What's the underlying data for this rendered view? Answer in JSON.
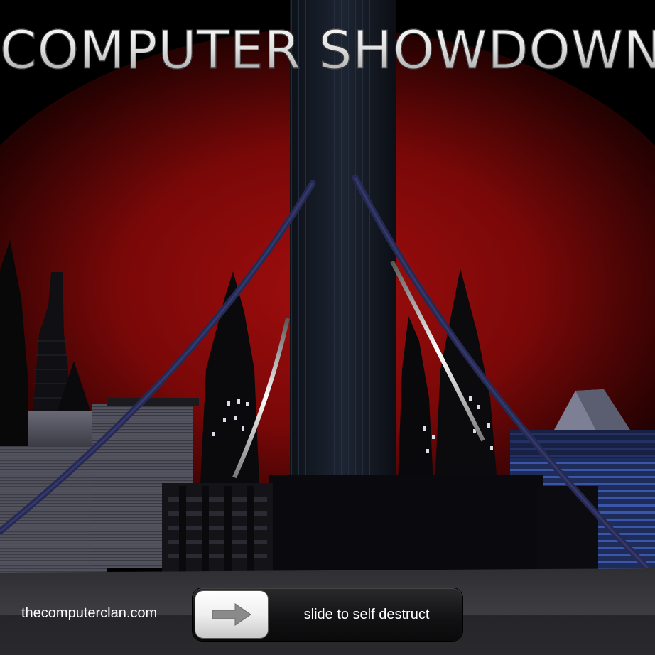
{
  "title": "COMPUTER SHOWDOWN",
  "footer": {
    "site_label": "thecomputerclan.com"
  },
  "slider": {
    "label": "slide to self destruct",
    "knob_icon": "arrow-right-icon",
    "progress": 0
  },
  "colors": {
    "sky_glow": "#8c0a0a",
    "sky_dark": "#000000",
    "tower": "#1b2330",
    "cable": "#2a2d55",
    "ground": "#3a3a3e"
  }
}
